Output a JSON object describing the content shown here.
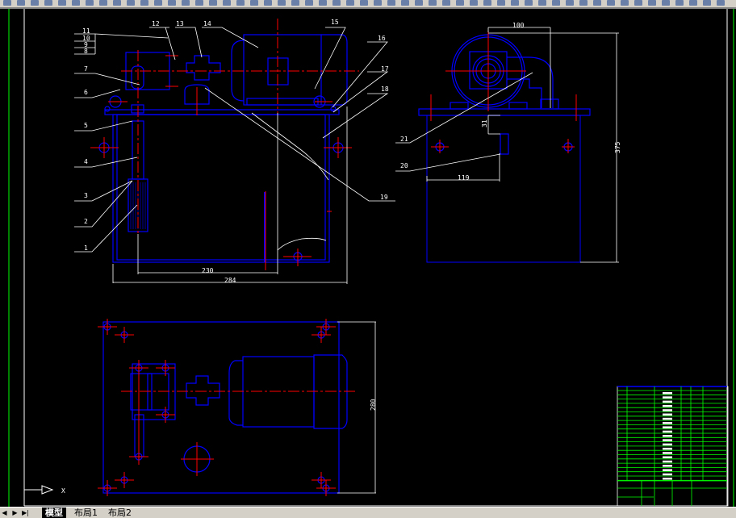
{
  "colors": {
    "background": "#000000",
    "outline": "#0000ff",
    "centerline": "#ff0000",
    "dimension": "#ffffff",
    "frame": "#00ff00"
  },
  "front_view": {
    "balloons_left": [
      "11",
      "10",
      "9",
      "8",
      "7",
      "6",
      "5",
      "4",
      "3",
      "2",
      "1"
    ],
    "balloons_top": [
      "12",
      "13",
      "14",
      "15"
    ],
    "balloons_right": [
      "16",
      "17",
      "18",
      "19"
    ],
    "dims": {
      "inner_width": "230",
      "outer_width": "284"
    }
  },
  "side_view": {
    "balloons": [
      "21",
      "20"
    ],
    "dims": {
      "offset": "100",
      "height": "375",
      "gauge_drop": "31",
      "gauge_pos": "119"
    }
  },
  "top_view": {
    "dims": {
      "depth": "280"
    }
  },
  "ucs": {
    "x_label": "X"
  },
  "tabs": [
    {
      "label": "模型",
      "active": true
    },
    {
      "label": "布局1",
      "active": false
    },
    {
      "label": "布局2",
      "active": false
    }
  ]
}
